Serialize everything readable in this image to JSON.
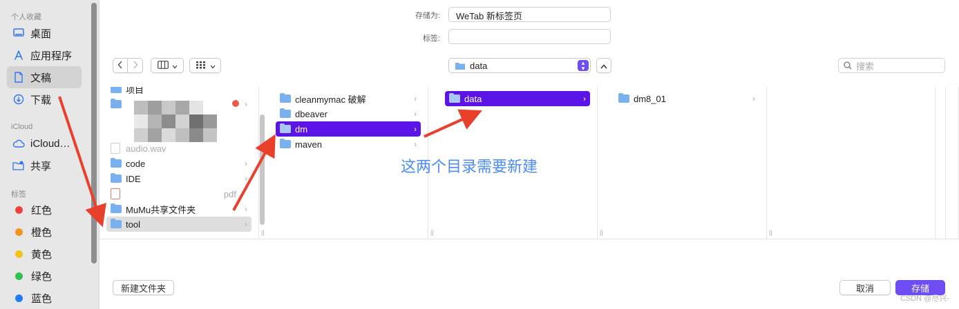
{
  "sidebar": {
    "favorites_header": "个人收藏",
    "favorites": [
      {
        "label": "桌面",
        "icon": "desktop-icon"
      },
      {
        "label": "应用程序",
        "icon": "applications-icon"
      },
      {
        "label": "文稿",
        "icon": "document-icon"
      },
      {
        "label": "下载",
        "icon": "download-icon"
      }
    ],
    "icloud_header": "iCloud",
    "icloud": [
      {
        "label": "iCloud…",
        "icon": "cloud-icon"
      },
      {
        "label": "共享",
        "icon": "shared-folder-icon"
      }
    ],
    "tags_header": "标签",
    "tags": [
      {
        "label": "红色",
        "color": "#f0443a"
      },
      {
        "label": "橙色",
        "color": "#f39320"
      },
      {
        "label": "黄色",
        "color": "#f4c21a"
      },
      {
        "label": "绿色",
        "color": "#30c24c"
      },
      {
        "label": "蓝色",
        "color": "#1f7cf3"
      }
    ]
  },
  "form": {
    "save_as_label": "存储为:",
    "save_as_value": "WeTab 新标签页",
    "tags_label": "标签:",
    "tags_value": ""
  },
  "toolbar": {
    "back_icon": "chevron-left-icon",
    "forward_icon": "chevron-right-icon",
    "path_value": "data",
    "search_placeholder": "搜索"
  },
  "columns": {
    "col1": [
      {
        "label": "项目"
      },
      {
        "label": "code"
      },
      {
        "label": "IDE"
      },
      {
        "label": "MuMu共享文件夹"
      },
      {
        "label": "tool"
      }
    ],
    "col1_file": "audio.wav",
    "col1_pdf": "pdf",
    "col2": [
      {
        "label": "cleanmymac 破解"
      },
      {
        "label": "dbeaver"
      },
      {
        "label": "dm"
      },
      {
        "label": "maven"
      }
    ],
    "col3": [
      {
        "label": "data"
      }
    ],
    "col4": [
      {
        "label": "dm8_01"
      }
    ]
  },
  "annotation": "这两个目录需要新建",
  "footer": {
    "new_folder_label": "新建文件夹",
    "cancel_label": "取消",
    "save_label": "存储"
  },
  "watermark": "CSDN @尽兴-",
  "colors": {
    "accent": "#6e4df3",
    "selection": "#5b13e6",
    "arrow": "#e8402a"
  }
}
